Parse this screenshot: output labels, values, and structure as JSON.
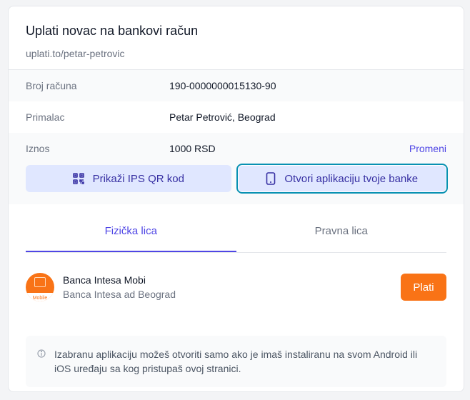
{
  "header": {
    "title": "Uplati novac na bankovi račun",
    "url": "uplati.to/petar-petrovic"
  },
  "details": [
    {
      "label": "Broj računa",
      "value": "190-0000000015130-90"
    },
    {
      "label": "Primalac",
      "value": "Petar Petrović, Beograd"
    },
    {
      "label": "Iznos",
      "value": "1000 RSD",
      "action": "Promeni"
    }
  ],
  "buttons": {
    "qr_label": "Prikaži IPS QR kod",
    "qr_icon": "qr-code-icon",
    "app_label": "Otvori aplikaciju tvoje banke",
    "app_icon": "smartphone-icon"
  },
  "tabs": [
    {
      "label": "Fizička lica",
      "active": true
    },
    {
      "label": "Pravna lica",
      "active": false
    }
  ],
  "bank": {
    "name": "Banca Intesa Mobi",
    "subtitle": "Banca Intesa ad Beograd",
    "logo_text": "Mobile",
    "pay_label": "Plati"
  },
  "note": {
    "text": "Izabranu aplikaciju možeš otvoriti samo ako je imaš instaliranu na svom Android ili iOS uređaju sa kog pristupaš ovoj stranici.",
    "icon": "info-icon"
  },
  "colors": {
    "accent": "#4f46e5",
    "button_bg": "#e0e7ff",
    "focus_ring": "#0891b2",
    "brand_orange": "#f97316"
  }
}
